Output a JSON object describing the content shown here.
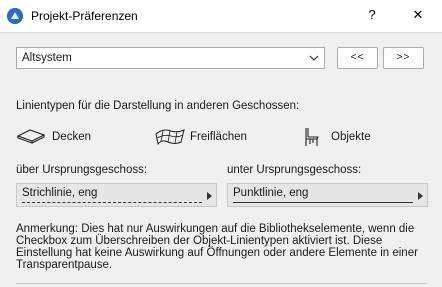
{
  "window": {
    "title": "Projekt-Präferenzen",
    "help_label": "?",
    "close_label": "✕"
  },
  "preset": {
    "selected": "Altsystem",
    "prev_label": "<<",
    "next_label": ">>"
  },
  "section": {
    "heading": "Linientypen für die Darstellung in anderen Geschossen:",
    "items": [
      {
        "label": "Decken",
        "icon": "slab-icon"
      },
      {
        "label": "Freiflächen",
        "icon": "mesh-icon"
      },
      {
        "label": "Objekte",
        "icon": "chair-icon"
      }
    ]
  },
  "above": {
    "label": "über Ursprungsgeschoss:",
    "value": "Strichlinie, eng",
    "line_style": "dashed"
  },
  "below": {
    "label": "unter Ursprungsgeschoss:",
    "value": "Punktlinie, eng",
    "line_style": "solid"
  },
  "note": "Anmerkung: Dies hat nur Auswirkungen auf die Bibliothekselemente, wenn die Checkbox zum Überschreiben der Objekt-Linientypen aktiviert ist. Diese Einstellung hat keine Auswirkung auf Öffnungen oder andere Elemente in einer Transparentpause."
}
